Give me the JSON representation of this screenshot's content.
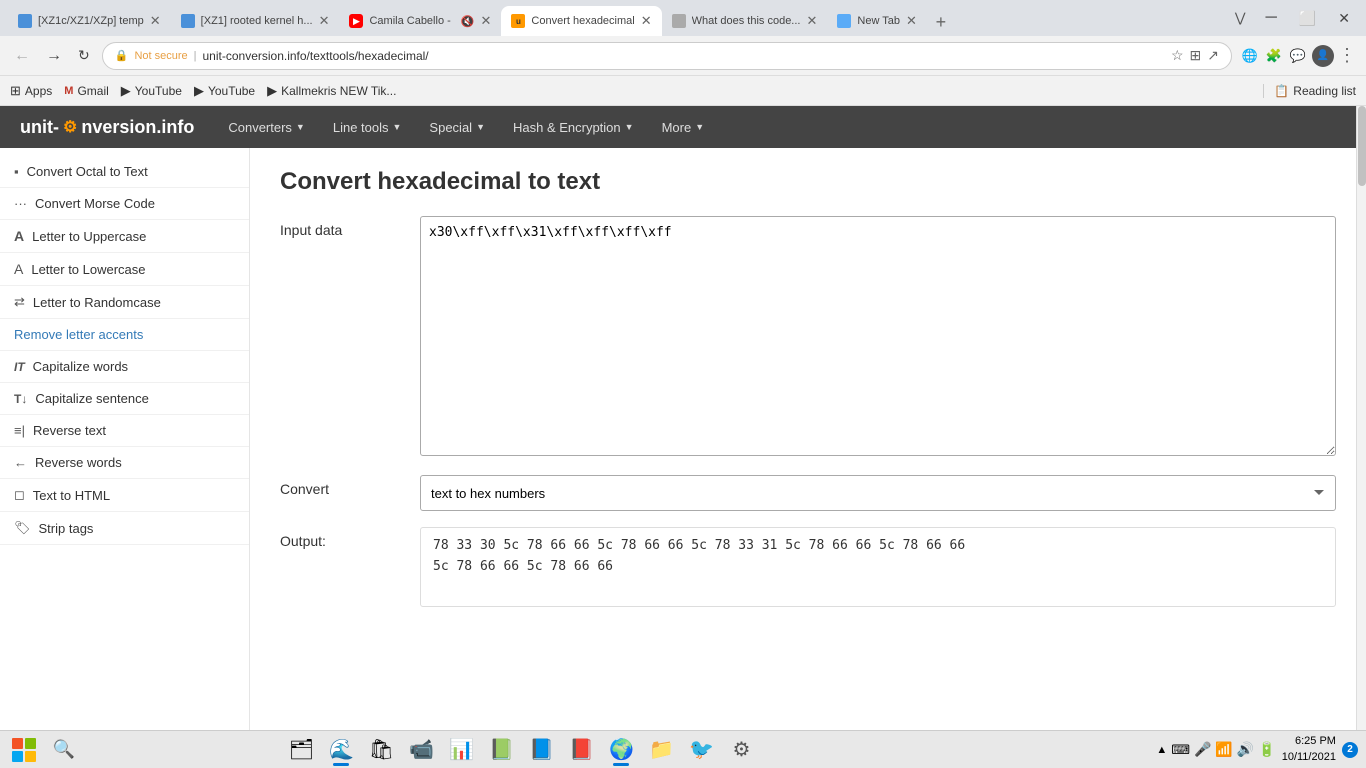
{
  "browser": {
    "tabs": [
      {
        "id": "tab1",
        "title": "[XZ1c/XZ1/XZp] temp",
        "active": false,
        "favicon_color": "#4a90d9"
      },
      {
        "id": "tab2",
        "title": "[XZ1] rooted kernel h...",
        "active": false,
        "favicon_color": "#4a90d9"
      },
      {
        "id": "tab3",
        "title": "Camila Cabello -",
        "active": false,
        "favicon_color": "#ff0000"
      },
      {
        "id": "tab4",
        "title": "Convert hexadecimal",
        "active": true,
        "favicon_color": "#f90"
      },
      {
        "id": "tab5",
        "title": "What does this code...",
        "active": false,
        "favicon_color": "#aaa"
      },
      {
        "id": "tab6",
        "title": "New Tab",
        "active": false,
        "favicon_color": "#ddd"
      }
    ],
    "address": "unit-conversion.info/texttools/hexadecimal/",
    "security": "Not secure",
    "bookmarks": [
      {
        "label": "Apps"
      },
      {
        "label": "Gmail"
      },
      {
        "label": "YouTube"
      },
      {
        "label": "YouTube"
      },
      {
        "label": "Kallmekris NEW Tik..."
      }
    ],
    "reading_list": "Reading list"
  },
  "site_nav": {
    "logo": "unit-c",
    "logo_suffix": "nversion.info",
    "items": [
      {
        "label": "Converters",
        "has_arrow": true
      },
      {
        "label": "Line tools",
        "has_arrow": true
      },
      {
        "label": "Special",
        "has_arrow": true
      },
      {
        "label": "Hash & Encryption",
        "has_arrow": true
      },
      {
        "label": "More",
        "has_arrow": true
      }
    ]
  },
  "sidebar": {
    "items": [
      {
        "icon": "▪",
        "label": "Convert Octal to Text"
      },
      {
        "icon": "···",
        "label": "Convert Morse Code"
      },
      {
        "icon": "A",
        "label": "Letter to Uppercase"
      },
      {
        "icon": "A",
        "label": "Letter to Lowercase"
      },
      {
        "icon": "⇄",
        "label": "Letter to Randomcase"
      },
      {
        "icon": "",
        "label": "Remove letter accents",
        "is_link": true
      },
      {
        "icon": "IT",
        "label": "Capitalize words"
      },
      {
        "icon": "T↓",
        "label": "Capitalize sentence"
      },
      {
        "icon": "≡|",
        "label": "Reverse text"
      },
      {
        "icon": "←",
        "label": "Reverse words"
      },
      {
        "icon": "◻",
        "label": "Text to HTML"
      },
      {
        "icon": "🏷",
        "label": "Strip tags"
      }
    ]
  },
  "main": {
    "page_title": "Convert hexadecimal to text",
    "input_label": "Input data",
    "input_value": "x30\\xff\\xff\\x31\\xff\\xff\\xff\\xff",
    "convert_label": "Convert",
    "convert_options": [
      {
        "value": "text_to_hex",
        "label": "text to hex numbers"
      }
    ],
    "selected_option": "text to hex numbers",
    "output_label": "Output:",
    "output_value": "78 33 30 5c 78 66 66 5c 78 66 66 5c 78 33 31 5c 78 66 66 5c 78 66 66\n5c 78 66 66 5c 78 66 66"
  },
  "taskbar": {
    "apps": [
      {
        "name": "file-explorer",
        "icon": "🗂"
      },
      {
        "name": "browser-edge",
        "icon": "🌐"
      },
      {
        "name": "zoom",
        "icon": "📹"
      },
      {
        "name": "powerpoint-pin",
        "icon": "📊"
      },
      {
        "name": "excel",
        "icon": "📗"
      },
      {
        "name": "word",
        "icon": "📘"
      },
      {
        "name": "powerpoint",
        "icon": "📕"
      },
      {
        "name": "chrome",
        "icon": "🌍"
      },
      {
        "name": "files",
        "icon": "📁"
      },
      {
        "name": "bird-app",
        "icon": "🐦"
      },
      {
        "name": "settings",
        "icon": "⚙"
      }
    ],
    "clock_time": "6:25 PM",
    "clock_date": "10/11/2021",
    "notification_count": "2"
  }
}
